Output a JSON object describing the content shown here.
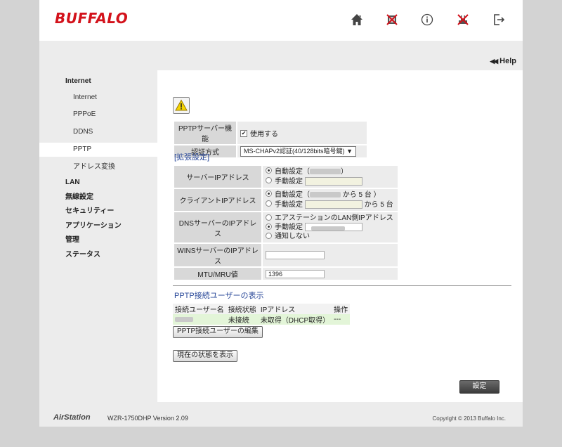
{
  "brand": "BUFFALO",
  "header_icons": [
    "home-icon",
    "network-disconnected-icon",
    "info-icon",
    "wireless-disconnected-icon",
    "logout-icon"
  ],
  "help": "Help",
  "sidebar": {
    "items": [
      {
        "label": "Internet",
        "level": "main"
      },
      {
        "label": "Internet",
        "level": "sub"
      },
      {
        "label": "PPPoE",
        "level": "sub"
      },
      {
        "label": "DDNS",
        "level": "sub"
      },
      {
        "label": "PPTP",
        "level": "sub",
        "active": true
      },
      {
        "label": "アドレス変換",
        "level": "sub"
      },
      {
        "label": "LAN",
        "level": "main"
      },
      {
        "label": "無線設定",
        "level": "main"
      },
      {
        "label": "セキュリティー",
        "level": "main"
      },
      {
        "label": "アプリケーション",
        "level": "main"
      },
      {
        "label": "管理",
        "level": "main"
      },
      {
        "label": "ステータス",
        "level": "main"
      }
    ]
  },
  "pptp": {
    "server_label": "PPTPサーバー機能",
    "server_checkbox_label": "使用する",
    "auth_label": "認証方式",
    "auth_value": "MS-CHAPv2認証(40/128bits暗号鍵)"
  },
  "extended": {
    "title": "[拡張設定]",
    "server_ip_label": "サーバーIPアドレス",
    "client_ip_label": "クライアントIPアドレス",
    "dns_label": "DNSサーバーのIPアドレス",
    "wins_label": "WINSサーバーのIPアドレス",
    "mtu_label": "MTU/MRU値",
    "auto": "自動設定（",
    "auto_close": "）",
    "manual": "手動設定",
    "client_auto_suffix": "から 5 台 ）",
    "client_manual_suffix": "から 5 台",
    "dns_option1": "エアステーションのLAN側IPアドレス",
    "dns_option3": "通知しない",
    "mtu_value": "1396"
  },
  "users": {
    "title": "PPTP接続ユーザーの表示",
    "columns": [
      "接続ユーザー名",
      "接続状態",
      "IPアドレス",
      "操作"
    ],
    "row": [
      "",
      "未接続",
      "未取得（DHCP取得）",
      "---"
    ],
    "edit_button": "PPTP接続ユーザーの編集",
    "status_button": "現在の状態を表示"
  },
  "submit": "設定",
  "footer": {
    "brand": "AirStation",
    "model": "WZR-1750DHP   Version 2.09",
    "copyright": "Copyright © 2013 Buffalo Inc."
  }
}
